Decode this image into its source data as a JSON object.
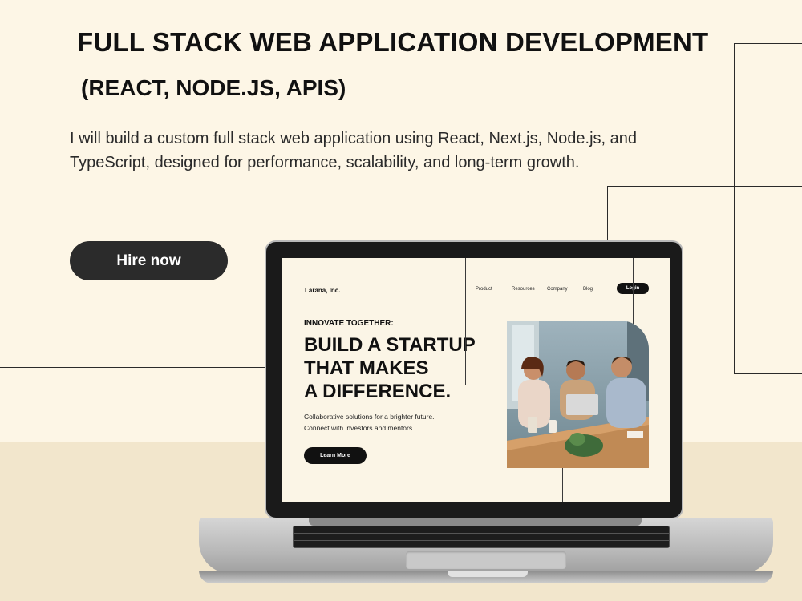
{
  "header": {
    "title_line1": "FULL STACK WEB APPLICATION DEVELOPMENT",
    "title_line2": "(REACT, NODE.JS, APIS)",
    "description": "I will build a custom full stack web application using React, Next.js, Node.js, and TypeScript, designed for performance, scalability, and long-term growth."
  },
  "cta": {
    "hire_label": "Hire now"
  },
  "site": {
    "logo": "Larana, Inc.",
    "nav": [
      "Product",
      "Resources",
      "Company",
      "Blog"
    ],
    "login_label": "Login",
    "eyebrow": "INNOVATE TOGETHER:",
    "headline": [
      "BUILD A STARTUP",
      "THAT MAKES",
      "A DIFFERENCE."
    ],
    "subtext": [
      "Collaborative solutions for a brighter future.",
      "Connect with investors and mentors."
    ],
    "learn_more_label": "Learn More"
  },
  "colors": {
    "background": "#fdf6e6",
    "floor": "#f2e6cc",
    "button": "#2b2b2b",
    "text": "#141414"
  }
}
